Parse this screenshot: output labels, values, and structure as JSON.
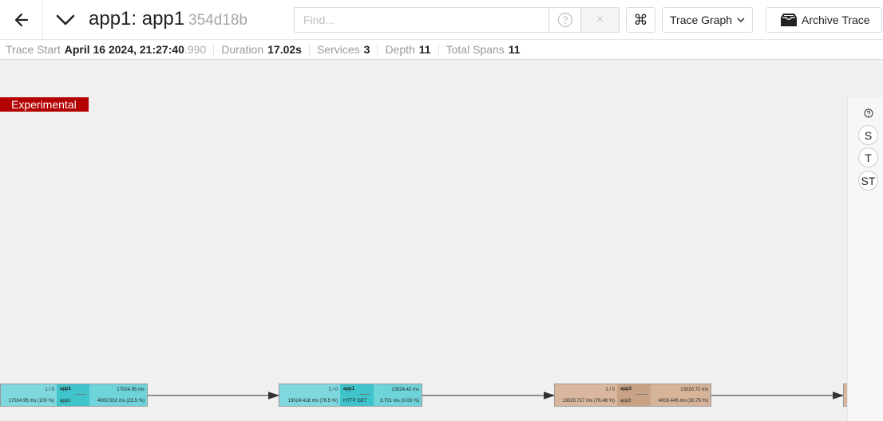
{
  "header": {
    "title": "app1: app1",
    "trace_id": "354d18b",
    "find_placeholder": "Find...",
    "keyboard_icon": "⌘",
    "view_label": "Trace Graph",
    "archive_label": "Archive Trace",
    "clear_icon": "×"
  },
  "summary": {
    "start_label": "Trace Start",
    "start_value": "April 16 2024, 21:27:40",
    "start_ms": ".990",
    "duration_label": "Duration",
    "duration_value": "17.02s",
    "services_label": "Services",
    "services_value": "3",
    "depth_label": "Depth",
    "depth_value": "11",
    "spans_label": "Total Spans",
    "spans_value": "11"
  },
  "graph": {
    "experimental_label": "Experimental",
    "toolbar": {
      "s_label": "S",
      "t_label": "T",
      "st_label": "ST"
    },
    "colors": {
      "app1": "#3fc4cb",
      "app3": "#c9a184",
      "experimental": "#b30000"
    },
    "nodes": [
      {
        "count": "1 / 0",
        "total_time": "17024.95 ms (100 %)",
        "service": "app1",
        "operation": "app1",
        "self_time": "17024.95 ms",
        "self_pct": "4000.532 ms (23.5 %)"
      },
      {
        "count": "1 / 0",
        "total_time": "13024.418 ms (76.5 %)",
        "service": "app1",
        "operation": "HTTP GET",
        "self_time": "13024.42 ms",
        "self_pct": "3.701 ms (0.03 %)"
      },
      {
        "count": "1 / 0",
        "total_time": "13020.717 ms (76.48 %)",
        "service": "app3",
        "operation": "app3",
        "self_time": "13020.72 ms",
        "self_pct": "4003.445 ms (30.75 %)"
      }
    ]
  }
}
